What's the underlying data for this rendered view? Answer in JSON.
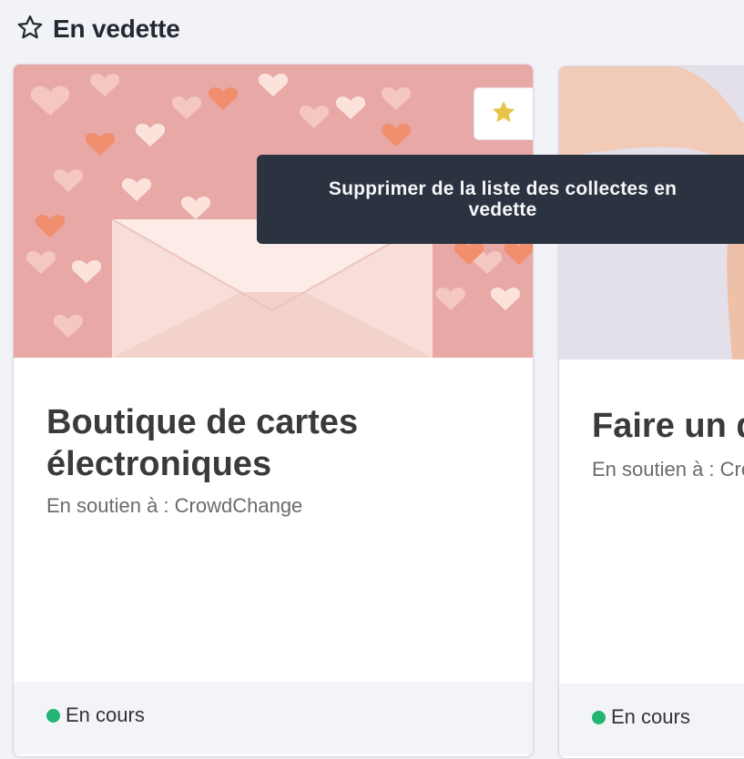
{
  "section": {
    "title": "En vedette",
    "icon": "star-outline-icon"
  },
  "cards": [
    {
      "title": "Boutique de cartes électroniques",
      "support": "En soutien à : CrowdChange",
      "status": "En cours",
      "status_color": "#22b573",
      "favorite_icon": "star-filled-icon",
      "image": "envelope-hearts-photo"
    },
    {
      "title": "Faire un d",
      "support": "En soutien à : Cro",
      "status": "En cours",
      "status_color": "#22b573",
      "image": "hands-photo"
    }
  ],
  "tooltip": {
    "text": "Supprimer de la liste des collectes en vedette"
  },
  "colors": {
    "background": "#f2f3f7",
    "tooltip_bg": "#2b3240",
    "star": "#e8c547",
    "status_green": "#22b573"
  }
}
